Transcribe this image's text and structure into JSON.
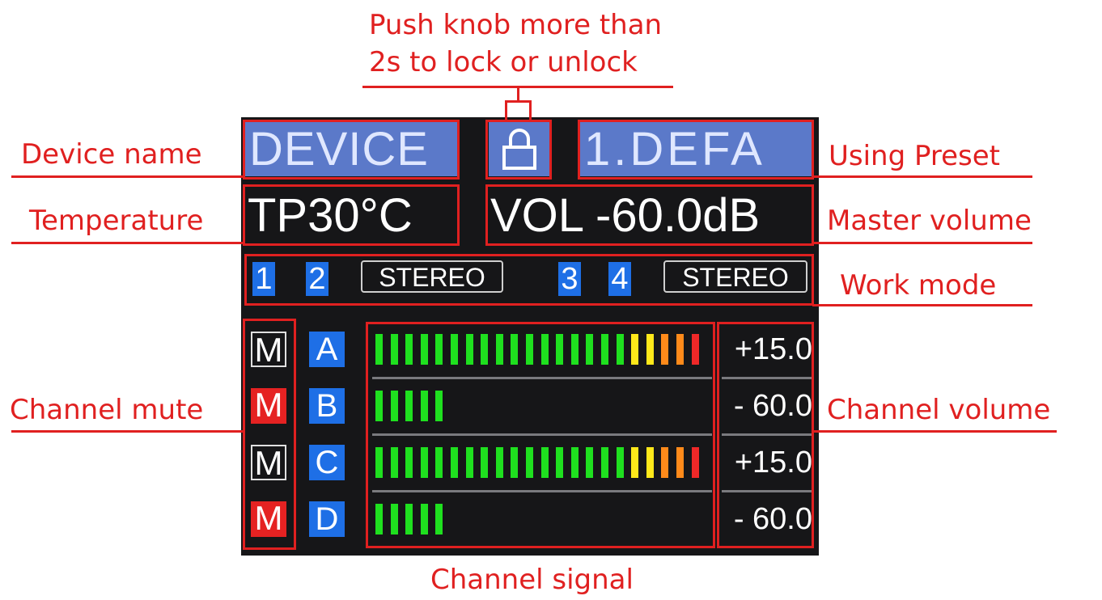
{
  "annotations": {
    "lock_hint_line1": "Push knob more than",
    "lock_hint_line2": "2s to lock or unlock",
    "device_name": "Device name",
    "temperature": "Temperature",
    "channel_mute": "Channel mute",
    "using_preset": "Using Preset",
    "master_volume": "Master volume",
    "work_mode": "Work mode",
    "channel_volume": "Channel volume",
    "channel_signal": "Channel signal"
  },
  "screen": {
    "device_name": "DEVICE",
    "lock_icon": "lock-icon",
    "preset": "1.DEFA",
    "temperature": "TP30°C",
    "master_volume": "VOL -60.0dB",
    "work_mode": {
      "group1": {
        "channels": [
          "1",
          "2"
        ],
        "mode": "STEREO"
      },
      "group2": {
        "channels": [
          "3",
          "4"
        ],
        "mode": "STEREO"
      }
    },
    "channels": [
      {
        "mute_label": "M",
        "muted": false,
        "name": "A",
        "level_segments": 22,
        "volume": "+15.0"
      },
      {
        "mute_label": "M",
        "muted": true,
        "name": "B",
        "level_segments": 5,
        "volume": "- 60.0"
      },
      {
        "mute_label": "M",
        "muted": false,
        "name": "C",
        "level_segments": 22,
        "volume": "+15.0"
      },
      {
        "mute_label": "M",
        "muted": true,
        "name": "D",
        "level_segments": 5,
        "volume": "- 60.0"
      }
    ]
  },
  "colors": {
    "annotation": "#e02020",
    "header_bar": "#5b79c9",
    "channel_badge": "#1e6fe6",
    "mute_active": "#e52222",
    "meter_green": "#1fe01f",
    "meter_yellow": "#ffe81a",
    "meter_orange": "#ff8a1a",
    "meter_red": "#ef2828"
  }
}
